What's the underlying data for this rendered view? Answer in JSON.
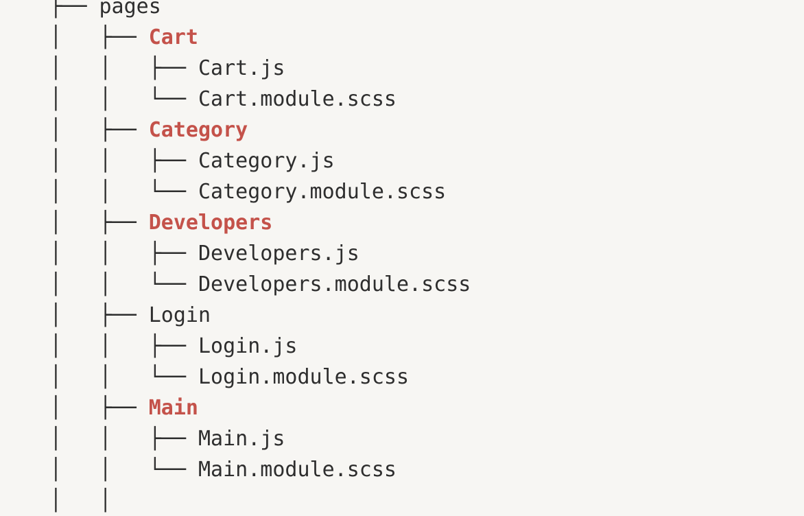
{
  "colors": {
    "background": "#f7f6f3",
    "text": "#2e2e2e",
    "highlight": "#c4524a"
  },
  "tree": {
    "lines": [
      {
        "prefix": "    ├── ",
        "name": "pages",
        "highlight": false
      },
      {
        "prefix": "    │   ├── ",
        "name": "Cart",
        "highlight": true
      },
      {
        "prefix": "    │   │   ├── ",
        "name": "Cart.js",
        "highlight": false
      },
      {
        "prefix": "    │   │   └── ",
        "name": "Cart.module.scss",
        "highlight": false
      },
      {
        "prefix": "    │   ├── ",
        "name": "Category",
        "highlight": true
      },
      {
        "prefix": "    │   │   ├── ",
        "name": "Category.js",
        "highlight": false
      },
      {
        "prefix": "    │   │   └── ",
        "name": "Category.module.scss",
        "highlight": false
      },
      {
        "prefix": "    │   ├── ",
        "name": "Developers",
        "highlight": true
      },
      {
        "prefix": "    │   │   ├── ",
        "name": "Developers.js",
        "highlight": false
      },
      {
        "prefix": "    │   │   └── ",
        "name": "Developers.module.scss",
        "highlight": false
      },
      {
        "prefix": "    │   ├── ",
        "name": "Login",
        "highlight": false
      },
      {
        "prefix": "    │   │   ├── ",
        "name": "Login.js",
        "highlight": false
      },
      {
        "prefix": "    │   │   └── ",
        "name": "Login.module.scss",
        "highlight": false
      },
      {
        "prefix": "    │   ├── ",
        "name": "Main",
        "highlight": true
      },
      {
        "prefix": "    │   │   ├── ",
        "name": "Main.js",
        "highlight": false
      },
      {
        "prefix": "    │   │   └── ",
        "name": "Main.module.scss",
        "highlight": false
      },
      {
        "prefix": "    │   │",
        "name": "",
        "highlight": false
      }
    ]
  }
}
